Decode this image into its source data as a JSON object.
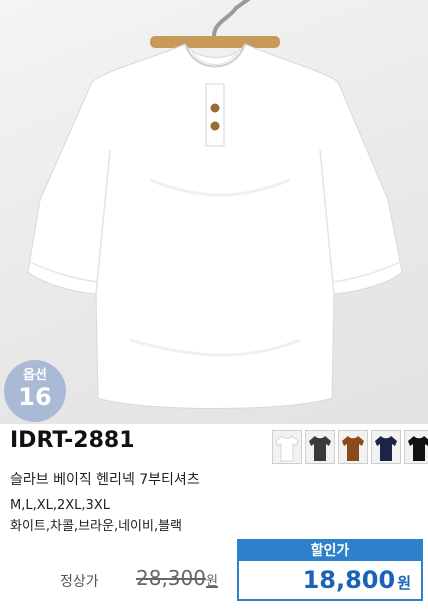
{
  "product": {
    "code": "IDRT-2881",
    "name": "슬라브 베이직 헨리넥 7부티셔츠",
    "sizes": "M,L,XL,2XL,3XL",
    "colors": "화이트,차콜,브라운,네이비,블랙"
  },
  "option_badge": {
    "label": "옵션",
    "count": "16"
  },
  "swatches": [
    {
      "name": "화이트",
      "color": "#ffffff"
    },
    {
      "name": "차콜",
      "color": "#3a3a3a"
    },
    {
      "name": "브라운",
      "color": "#8a4a1c"
    },
    {
      "name": "네이비",
      "color": "#1e2448"
    },
    {
      "name": "블랙",
      "color": "#111111"
    }
  ],
  "pricing": {
    "regular_label": "정상가",
    "regular_price": "28,300",
    "regular_unit": "원",
    "sale_label": "할인가",
    "sale_price": "18,800",
    "sale_unit": "원"
  },
  "colors": {
    "accent": "#2d80c9",
    "badge": "#a9b9d6"
  }
}
